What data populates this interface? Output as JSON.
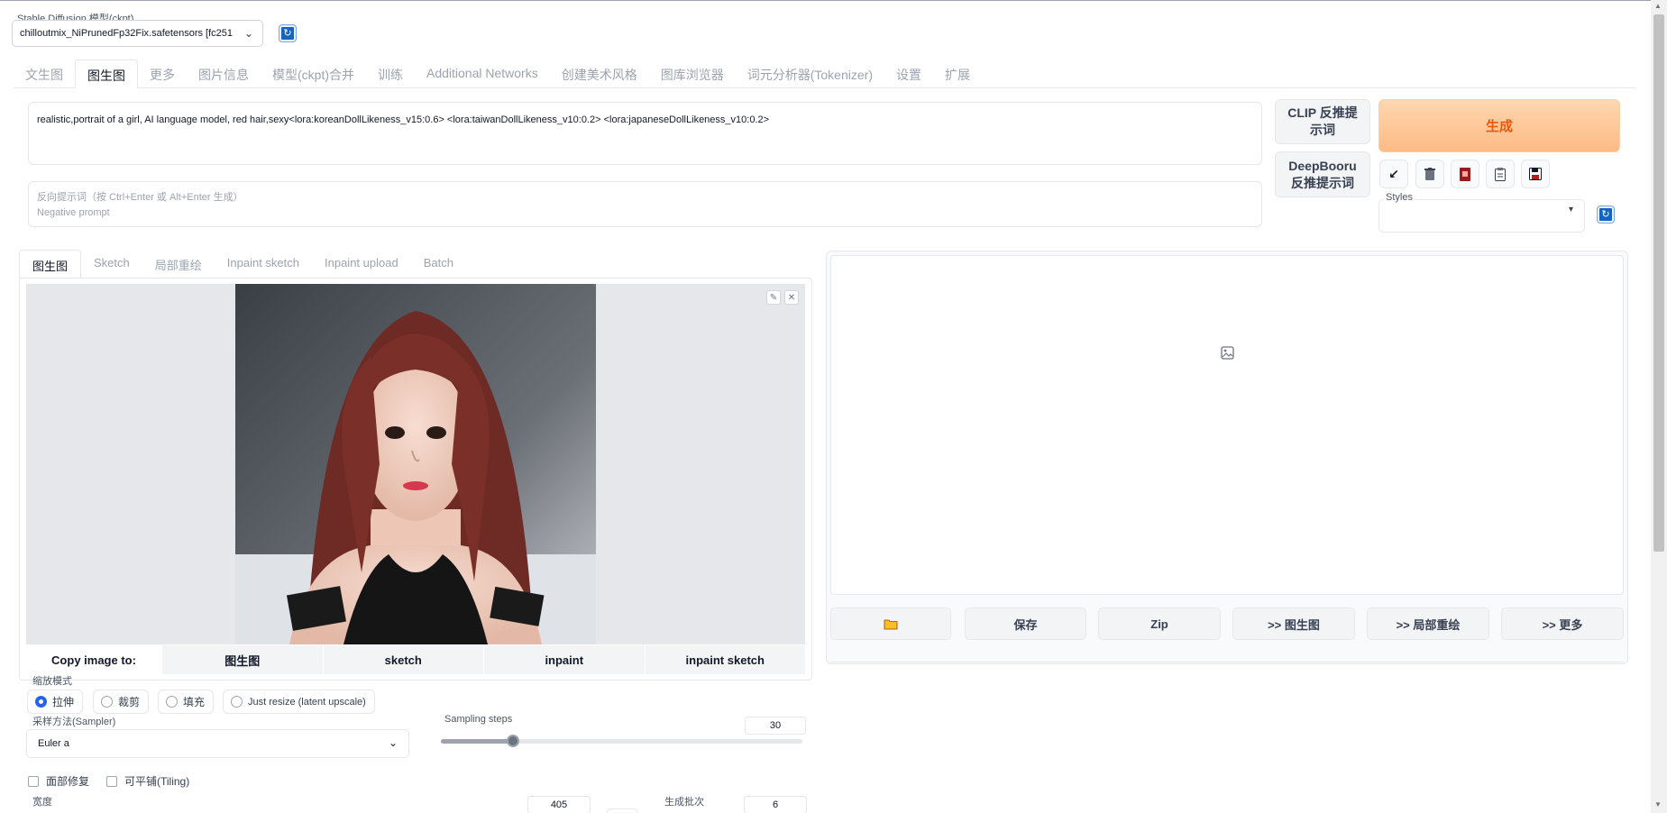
{
  "model": {
    "label": "Stable Diffusion 模型(ckpt)",
    "value": "chilloutmix_NiPrunedFp32Fix.safetensors [fc251"
  },
  "top_tabs": [
    {
      "label": "文生图",
      "active": false
    },
    {
      "label": "图生图",
      "active": true
    },
    {
      "label": "更多",
      "active": false
    },
    {
      "label": "图片信息",
      "active": false
    },
    {
      "label": "模型(ckpt)合并",
      "active": false
    },
    {
      "label": "训练",
      "active": false
    },
    {
      "label": "Additional Networks",
      "active": false
    },
    {
      "label": "创建美术风格",
      "active": false
    },
    {
      "label": "图库浏览器",
      "active": false
    },
    {
      "label": "词元分析器(Tokenizer)",
      "active": false
    },
    {
      "label": "设置",
      "active": false
    },
    {
      "label": "扩展",
      "active": false
    }
  ],
  "prompt": {
    "value": "realistic,portrait of a girl, AI language model, red hair,sexy<lora:koreanDollLikeness_v15:0.6> <lora:taiwanDollLikeness_v10:0.2> <lora:japaneseDollLikeness_v10:0.2>"
  },
  "negative_prompt": {
    "placeholder_cn": "反向提示词（按 Ctrl+Enter 或 Alt+Enter 生成）",
    "placeholder_en": "Negative prompt"
  },
  "buttons": {
    "clip": "CLIP 反推提示词",
    "deepbooru_line1": "DeepBooru",
    "deepbooru_line2": "反推提示词",
    "generate": "生成"
  },
  "styles": {
    "label": "Styles"
  },
  "sub_tabs": [
    {
      "label": "图生图",
      "active": true
    },
    {
      "label": "Sketch",
      "active": false
    },
    {
      "label": "局部重绘",
      "active": false
    },
    {
      "label": "Inpaint sketch",
      "active": false
    },
    {
      "label": "Inpaint upload",
      "active": false
    },
    {
      "label": "Batch",
      "active": false
    }
  ],
  "copy_image": {
    "label": "Copy image to:",
    "targets": [
      "图生图",
      "sketch",
      "inpaint",
      "inpaint sketch"
    ]
  },
  "resize_mode": {
    "label": "缩放模式",
    "options": [
      "拉伸",
      "裁剪",
      "填充",
      "Just resize (latent upscale)"
    ],
    "selected": "拉伸"
  },
  "sampler": {
    "label": "采样方法(Sampler)",
    "value": "Euler a"
  },
  "sampling_steps": {
    "label": "Sampling steps",
    "value": "30",
    "fraction": 0.2
  },
  "checkboxes": {
    "face_restore": "面部修复",
    "tiling": "可平铺(Tiling)"
  },
  "width": {
    "label": "宽度",
    "value": "405"
  },
  "batch_count": {
    "label": "生成批次",
    "value": "6"
  },
  "output_actions": {
    "save": "保存",
    "zip": "Zip",
    "to_img2img": ">> 图生图",
    "to_inpaint": ">> 局部重绘",
    "to_extras": ">> 更多"
  },
  "colors": {
    "accent_blue": "#2563eb",
    "generate_orange": "#ea580c",
    "generate_bg": "#fdba85"
  }
}
